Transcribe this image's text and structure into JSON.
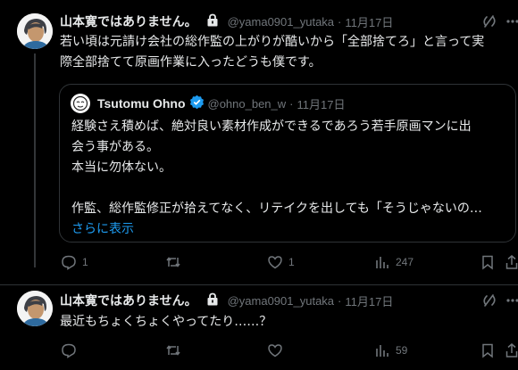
{
  "tweet1": {
    "display_name": "山本寛ではありません。",
    "handle": "@yama0901_yutaka",
    "separator": "·",
    "date": "11月17日",
    "text_line1": "若い頃は元請け会社の総作監の上がりが酷いから「全部捨てろ」と言って実",
    "text_line2": "際全部捨てて原画作業に入ったどうも僕です。",
    "quote": {
      "display_name": "Tsutomu Ohno",
      "handle": "@ohno_ben_w",
      "separator": "·",
      "date": "11月17日",
      "line1": "経験さえ積めば、絶対良い素材作成ができるであろう若手原画マンに出",
      "line2": "会う事がある。",
      "line3": "本当に勿体ない。",
      "line4": "作監、総作監修正が拾えてなく、リテイクを出しても「そうじゃないの…",
      "show_more": "さらに表示"
    },
    "actions": {
      "replies": "1",
      "retweets": "",
      "likes": "1",
      "views": "247"
    }
  },
  "tweet2": {
    "display_name": "山本寛ではありません。",
    "handle": "@yama0901_yutaka",
    "separator": "·",
    "date": "11月17日",
    "text": "最近もちょくちょくやってたり……？",
    "actions": {
      "views": "59"
    }
  },
  "icons": [
    "lock-icon",
    "grok-icon",
    "more-icon",
    "verified-icon",
    "reply-icon",
    "retweet-icon",
    "like-icon",
    "views-icon",
    "bookmark-icon",
    "share-icon"
  ],
  "colors": {
    "accent": "#1d9bf0",
    "muted": "#71767b",
    "text": "#e7e9ea",
    "background": "#000000",
    "border": "#2f3336"
  }
}
